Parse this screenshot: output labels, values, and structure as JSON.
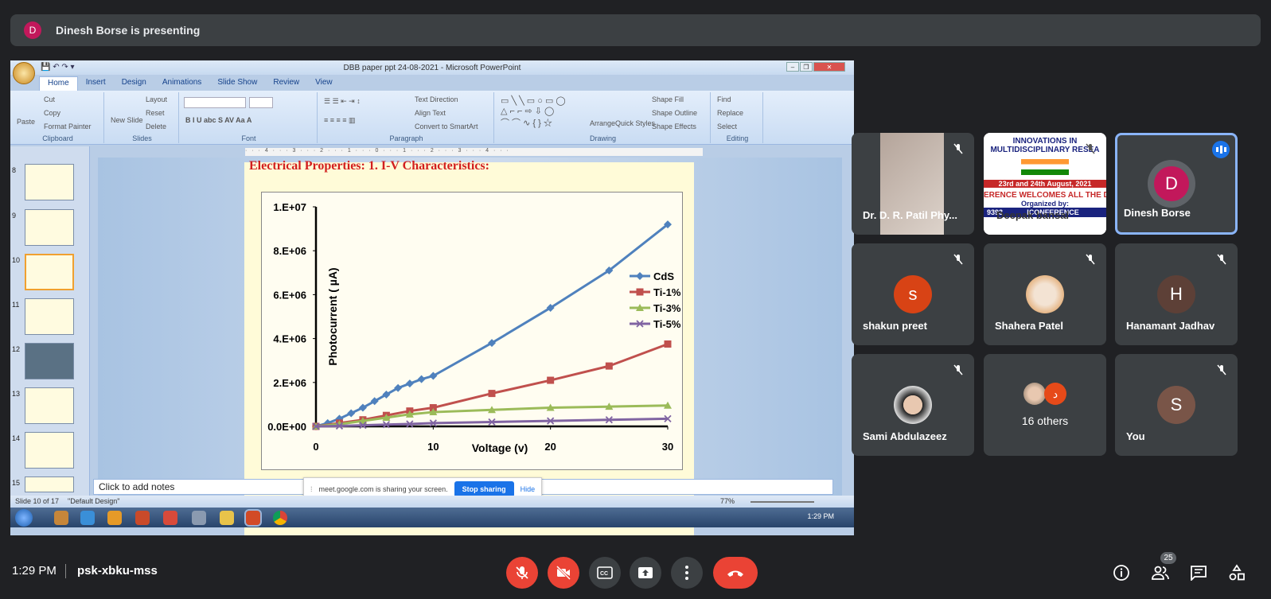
{
  "presenting": {
    "initial": "D",
    "text": "Dinesh Borse is presenting"
  },
  "powerpoint": {
    "title": "DBB  paper ppt      24-08-2021 - Microsoft PowerPoint",
    "tabs": [
      "Home",
      "Insert",
      "Design",
      "Animations",
      "Slide Show",
      "Review",
      "View"
    ],
    "ribbon": {
      "clipboard": {
        "label": "Clipboard",
        "paste": "Paste",
        "cut": "Cut",
        "copy": "Copy",
        "format_painter": "Format Painter"
      },
      "slides": {
        "label": "Slides",
        "new_slide": "New Slide",
        "layout": "Layout",
        "reset": "Reset",
        "delete": "Delete"
      },
      "font": {
        "label": "Font"
      },
      "paragraph": {
        "label": "Paragraph",
        "text_direction": "Text Direction",
        "align_text": "Align Text",
        "convert": "Convert to SmartArt"
      },
      "drawing": {
        "label": "Drawing",
        "arrange": "Arrange",
        "quick_styles": "Quick Styles",
        "shape_fill": "Shape Fill",
        "shape_outline": "Shape Outline",
        "shape_effects": "Shape Effects"
      },
      "editing": {
        "label": "Editing",
        "find": "Find",
        "replace": "Replace",
        "select": "Select"
      }
    },
    "thumb_numbers": [
      "8",
      "9",
      "10",
      "11",
      "12",
      "13",
      "14",
      "15"
    ],
    "slide_heading": "Electrical Properties: 1. I-V Characteristics:",
    "notes_placeholder": "Click to add notes",
    "status": {
      "slide": "Slide 10 of 17",
      "design": "\"Default Design\"",
      "zoom": "77%"
    },
    "taskbar_time": "1:29 PM"
  },
  "share_bar": {
    "text": "meet.google.com is sharing your screen.",
    "stop": "Stop sharing",
    "hide": "Hide"
  },
  "chart_data": {
    "type": "line",
    "title": "",
    "xlabel": "Voltage (v)",
    "ylabel": "Photocurrent ( µA)",
    "xlim": [
      0,
      30
    ],
    "ylim": [
      0,
      10000000
    ],
    "xticks": [
      "0",
      "10",
      "20",
      "30"
    ],
    "yticks": [
      "0.0E+00",
      "2.E+06",
      "4.E+06",
      "6.E+06",
      "8.E+06",
      "1.E+07"
    ],
    "legend_position": "right",
    "series": [
      {
        "name": "CdS",
        "color": "#4f81bd",
        "marker": "diamond",
        "x": [
          0,
          1,
          2,
          3,
          4,
          5,
          6,
          7,
          8,
          9,
          10,
          15,
          20,
          25,
          30
        ],
        "y": [
          0,
          150000,
          350000,
          600000,
          850000,
          1150000,
          1450000,
          1750000,
          1950000,
          2150000,
          2300000,
          3800000,
          5400000,
          7100000,
          9200000
        ]
      },
      {
        "name": "Ti-1%",
        "color": "#c0504d",
        "marker": "square",
        "x": [
          0,
          2,
          4,
          6,
          8,
          10,
          15,
          20,
          25,
          30
        ],
        "y": [
          0,
          150000,
          300000,
          500000,
          700000,
          850000,
          1500000,
          2100000,
          2750000,
          3750000
        ]
      },
      {
        "name": "Ti-3%",
        "color": "#9bbb59",
        "marker": "triangle",
        "x": [
          0,
          2,
          4,
          6,
          8,
          10,
          15,
          20,
          25,
          30
        ],
        "y": [
          0,
          100000,
          250000,
          400000,
          550000,
          650000,
          750000,
          850000,
          900000,
          950000
        ]
      },
      {
        "name": "Ti-5%",
        "color": "#8064a2",
        "marker": "x",
        "x": [
          0,
          2,
          4,
          6,
          8,
          10,
          15,
          20,
          25,
          30
        ],
        "y": [
          0,
          20000,
          50000,
          80000,
          110000,
          150000,
          200000,
          250000,
          300000,
          350000
        ]
      }
    ]
  },
  "participants": [
    {
      "name": "Dr. D. R. Patil Phy...",
      "muted": true,
      "type": "video"
    },
    {
      "name": "Deepak bansal",
      "muted": true,
      "type": "video",
      "banner": {
        "l1": "INNOVATIONS IN",
        "l2": "MULTIDISCIPLINARY RESEA",
        "l3": "23rd and 24th August, 2021",
        "l4": "ERENCE WELCOMES ALL THE DELI",
        "l5": "ICONFERENCE",
        "l6": "Organized by:",
        "l7": "9393"
      }
    },
    {
      "name": "Dinesh Borse",
      "initial": "D",
      "color": "#c2185b",
      "speaking": true
    },
    {
      "name": "shakun preet",
      "initial": "s",
      "color": "#d84315",
      "muted": true
    },
    {
      "name": "Shahera Patel",
      "avatar": "photo",
      "muted": true
    },
    {
      "name": "Hanamant Jadhav",
      "initial": "H",
      "color": "#5d4037",
      "muted": true
    },
    {
      "name": "Sami Abdulazeez",
      "avatar": "photo",
      "muted": true
    },
    {
      "name": "16 others",
      "avatar": "group",
      "extra_initial": "د"
    },
    {
      "name": "You",
      "initial": "S",
      "color": "#795548",
      "muted": true
    }
  ],
  "bottom": {
    "time": "1:29 PM",
    "code": "psk-xbku-mss",
    "people_count": "25"
  }
}
